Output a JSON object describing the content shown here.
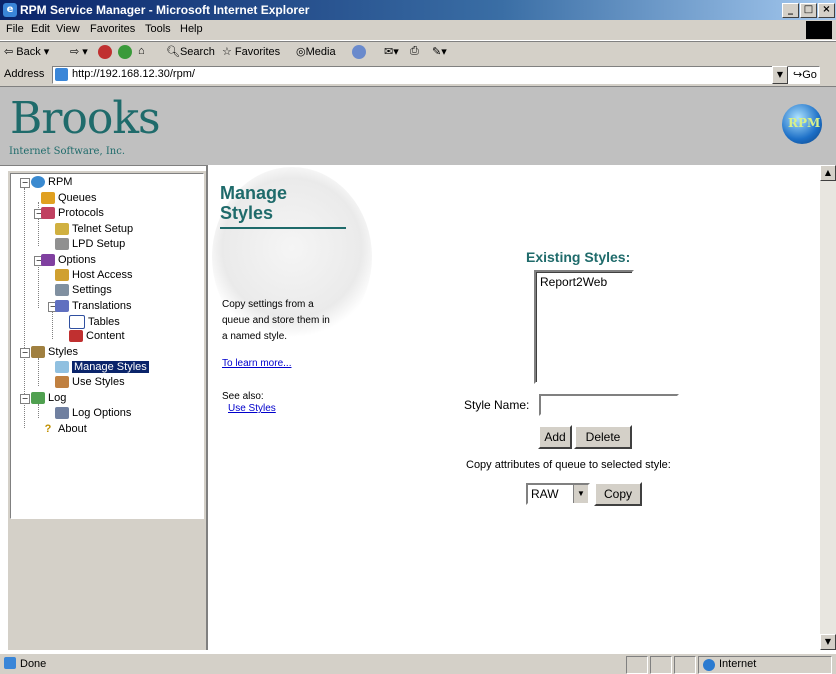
{
  "window": {
    "title": "RPM Service Manager - Microsoft Internet Explorer",
    "controls": [
      "_",
      "□",
      "×"
    ]
  },
  "menu": [
    "File",
    "Edit",
    "View",
    "Favorites",
    "Tools",
    "Help"
  ],
  "toolbar": {
    "back": "Back",
    "search": "Search",
    "favorites": "Favorites",
    "media": "Media"
  },
  "address": {
    "label": "Address",
    "url": "http://192.168.12.30/rpm/",
    "go": "Go"
  },
  "banner": {
    "brand": "Brooks",
    "brand_sub": "Internet Software, Inc.",
    "logo_text": "RPM"
  },
  "tree": {
    "root": "RPM",
    "queues": "Queues",
    "protocols": "Protocols",
    "telnet": "Telnet Setup",
    "lpd": "LPD Setup",
    "options": "Options",
    "host_access": "Host Access",
    "settings": "Settings",
    "translations": "Translations",
    "tables": "Tables",
    "content": "Content",
    "styles": "Styles",
    "manage_styles": "Manage Styles",
    "use_styles": "Use Styles",
    "log": "Log",
    "log_options": "Log Options",
    "about": "About"
  },
  "main": {
    "title_line1": "Manage",
    "title_line2": "Styles",
    "desc_line1": "Copy settings from a",
    "desc_line2": "queue and store them in",
    "desc_line3": "a named style.",
    "learn_more": "To learn more...",
    "see_also": "See also:",
    "see_also_link": "Use Styles",
    "existing_header": "Existing Styles:",
    "existing_styles": [
      "Report2Web"
    ],
    "style_name_label": "Style Name:",
    "style_name_value": "",
    "add_label": "Add",
    "delete_label": "Delete",
    "copy_attr_text": "Copy attributes of queue to selected style:",
    "queue_selected": "RAW",
    "copy_label": "Copy"
  },
  "status": {
    "text": "Done",
    "zone": "Internet"
  },
  "colors": {
    "accent": "#1f6b6b",
    "title_bar": "#0a246a",
    "selection": "#0a246a",
    "link": "#0000cc"
  }
}
